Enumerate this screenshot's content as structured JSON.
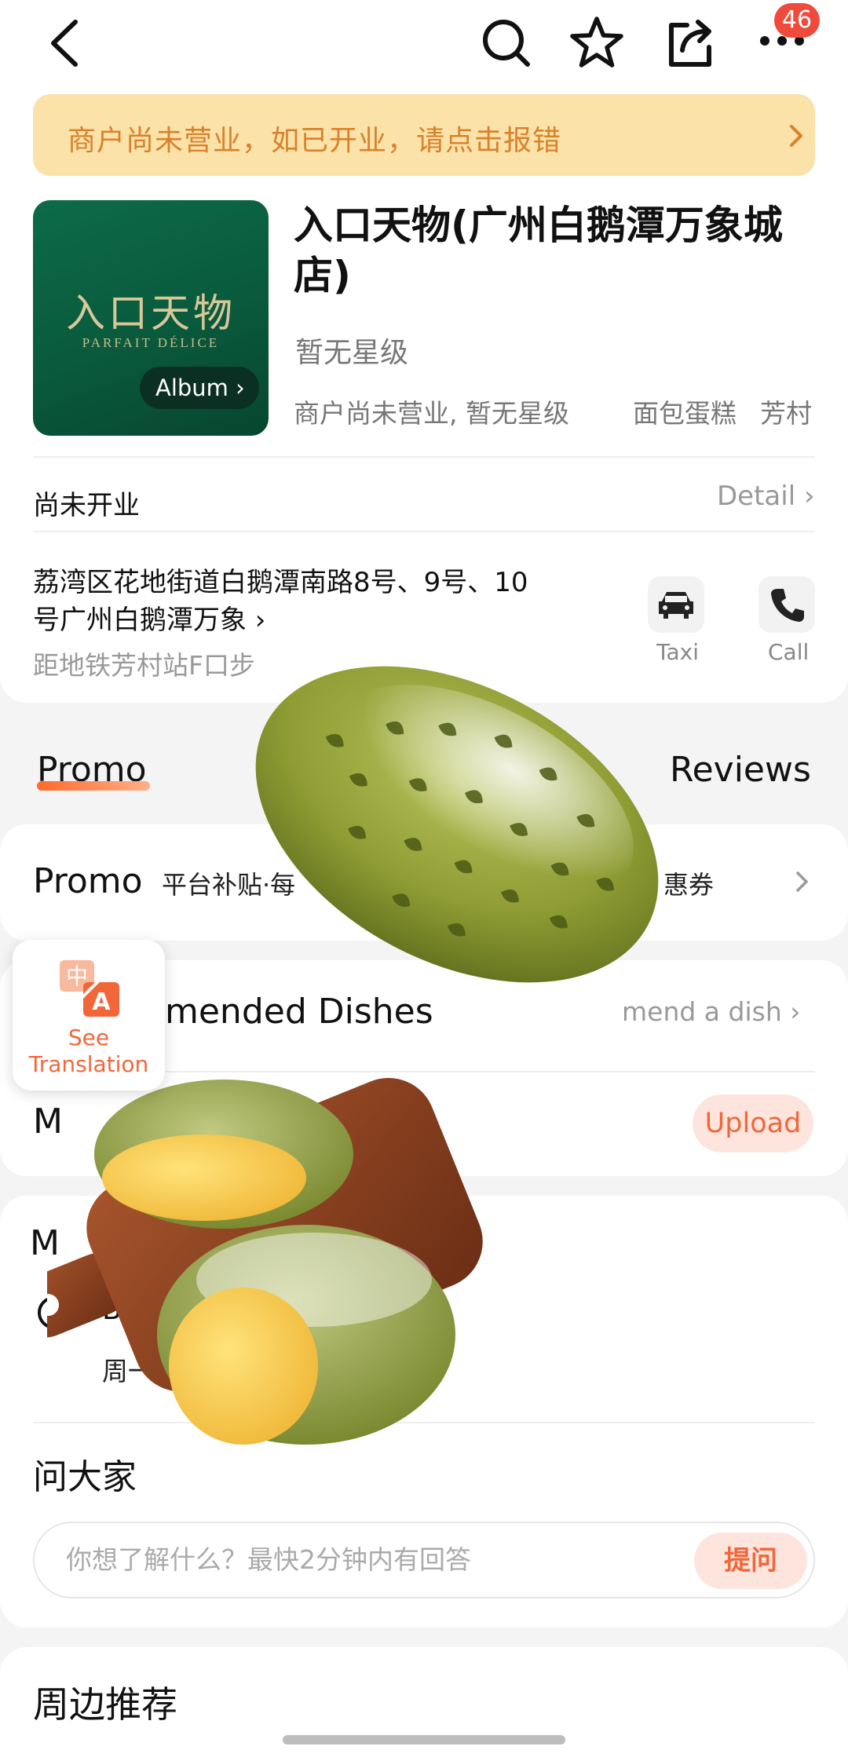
{
  "nav": {
    "back_icon": "chevron-left-icon",
    "search_icon": "search-icon",
    "favorite_icon": "star-icon",
    "share_icon": "share-icon",
    "more_icon": "more-dots-icon",
    "notification_badge": "46"
  },
  "banner": {
    "text": "商户尚未营业，如已开业，请点击报错",
    "background": "#fbe2a8",
    "text_color": "#d8822c"
  },
  "store": {
    "logo_cn": "入口天物",
    "logo_en": "PARFAIT DÉLICE",
    "album_label": "Album",
    "name": "入口天物(广州白鹅潭万象城店)",
    "rating": "暂无星级",
    "status_line": "商户尚未营业, 暂无星级",
    "category": "面包蛋糕",
    "area": "芳村"
  },
  "hours": {
    "label": "尚未开业",
    "detail_label": "Detail"
  },
  "address": {
    "text": "荔湾区花地街道白鹅潭南路8号、9号、10号广州白鹅潭万象",
    "subway": "距地铁芳村站F口步"
  },
  "actions": {
    "taxi_label": "Taxi",
    "call_label": "Call"
  },
  "tabs": {
    "promo": "Promo",
    "reviews": "Reviews"
  },
  "promo_row": {
    "title": "Promo",
    "subtitle": "平台补贴·每",
    "tail": "惠券"
  },
  "dishes_row": {
    "title": "mended Dishes",
    "action": "mend a dish"
  },
  "menu_row": {
    "title": "M",
    "upload_label": "Upload"
  },
  "more_card": {
    "title": "M",
    "business_label": "Busi",
    "weekdays": "周一至"
  },
  "qa": {
    "title": "问大家",
    "placeholder": "你想了解什么？最快2分钟内有回答",
    "ask_label": "提问"
  },
  "nearby": {
    "title": "周边推荐"
  },
  "translation": {
    "line1": "See",
    "line2": "Translation"
  },
  "colors": {
    "accent": "#f2673a",
    "brand_green": "#0c6b49"
  }
}
